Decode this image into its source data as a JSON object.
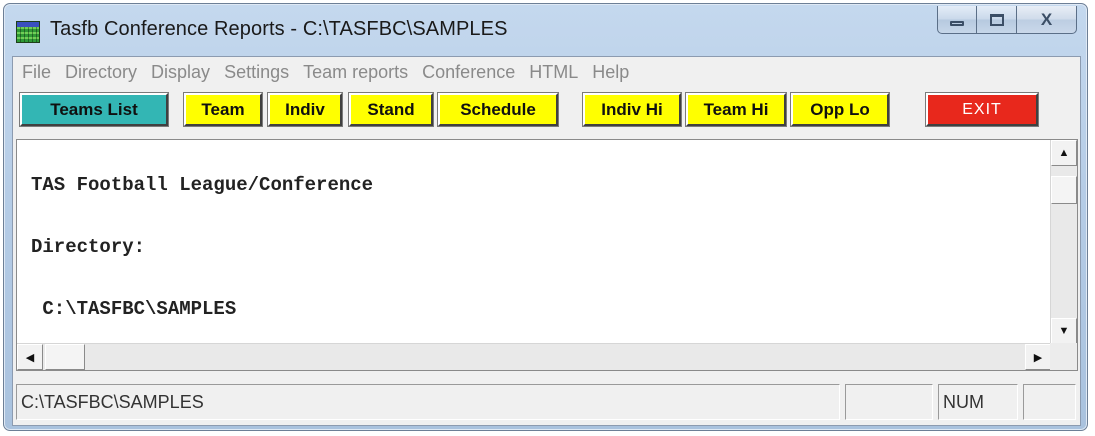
{
  "window": {
    "title": "Tasfb Conference Reports - C:\\TASFBC\\SAMPLES",
    "controls": {
      "minimize_icon": "minimize-icon",
      "maximize_icon": "maximize-icon",
      "close_glyph": "X"
    }
  },
  "menu": {
    "items": [
      {
        "label": "File"
      },
      {
        "label": "Directory"
      },
      {
        "label": "Display"
      },
      {
        "label": "Settings"
      },
      {
        "label": "Team reports"
      },
      {
        "label": "Conference"
      },
      {
        "label": "HTML"
      },
      {
        "label": "Help"
      }
    ]
  },
  "toolbar": {
    "buttons": [
      {
        "label": "Teams List",
        "color": "#33b6b4"
      },
      {
        "label": "Team",
        "color": "#ffff00"
      },
      {
        "label": "Indiv",
        "color": "#ffff00"
      },
      {
        "label": "Stand",
        "color": "#ffff00"
      },
      {
        "label": "Schedule",
        "color": "#ffff00"
      },
      {
        "label": "Indiv Hi",
        "color": "#ffff00"
      },
      {
        "label": "Team Hi",
        "color": "#ffff00"
      },
      {
        "label": "Opp Lo",
        "color": "#ffff00"
      },
      {
        "label": "EXIT",
        "color": "#e8281c"
      }
    ]
  },
  "content": {
    "lines": [
      "TAS Football League/Conference",
      "Directory:",
      " C:\\TASFBC\\SAMPLES"
    ]
  },
  "scrollbars": {
    "up_icon": "arrow-up-icon",
    "down_icon": "arrow-down-icon",
    "left_icon": "arrow-left-icon",
    "right_icon": "arrow-right-icon"
  },
  "status": {
    "path": "C:\\TASFBC\\SAMPLES",
    "panel2": "",
    "num": "NUM",
    "panel4": ""
  }
}
